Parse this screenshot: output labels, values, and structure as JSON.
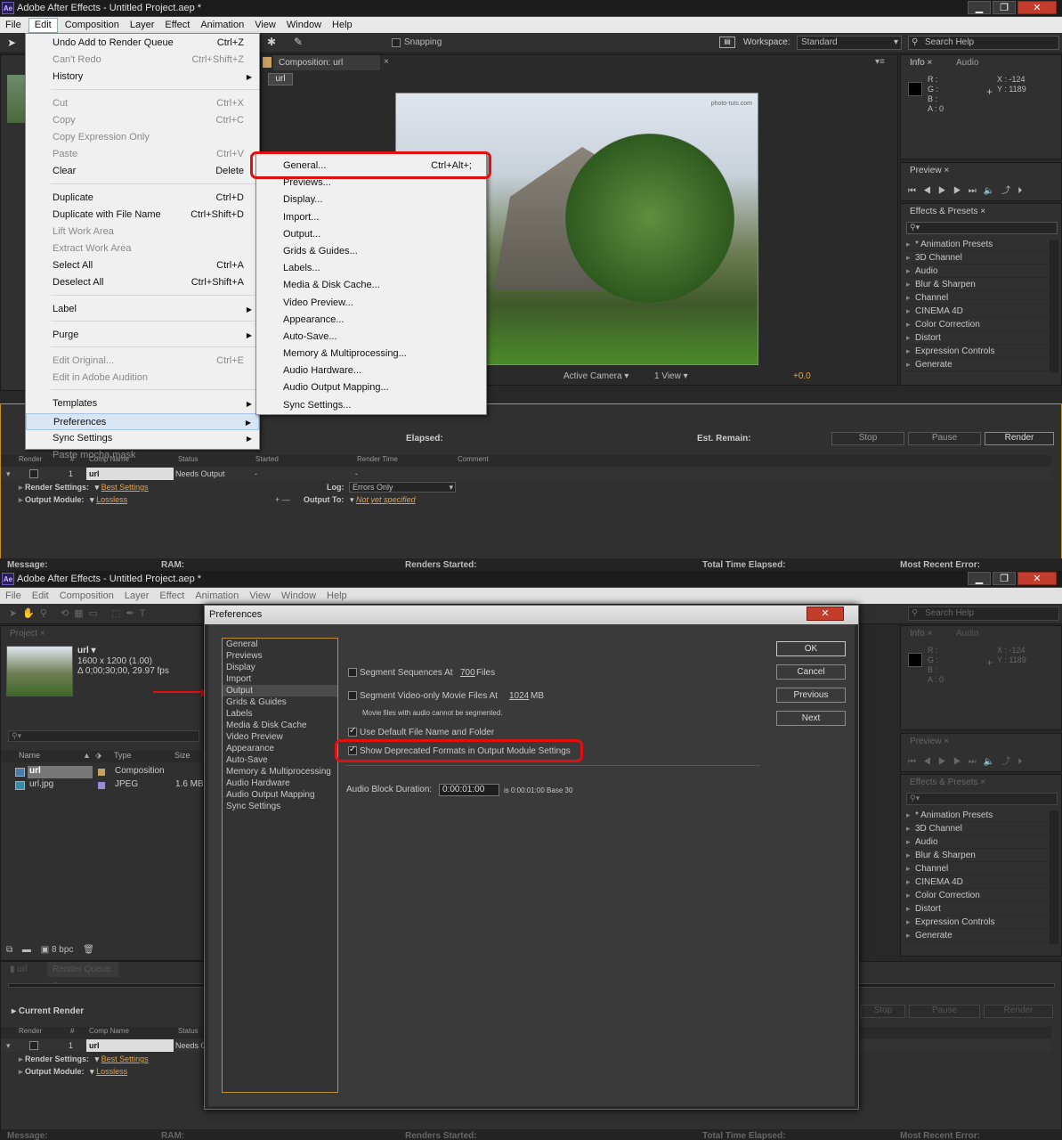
{
  "shot1": {
    "title": "Adobe After Effects - Untitled Project.aep *",
    "menus": [
      "File",
      "Edit",
      "Composition",
      "Layer",
      "Effect",
      "Animation",
      "View",
      "Window",
      "Help"
    ],
    "active_menu": "Edit",
    "snapping": "Snapping",
    "workspace_label": "Workspace:",
    "workspace_value": "Standard",
    "search_help": "Search Help",
    "comp_tab": "Composition: url",
    "comp_name": "url",
    "watermark": "photo-tuts.com",
    "active_camera": "Active Camera",
    "view_count": "1 View",
    "exposure": "+0.0",
    "info_tab": "Info",
    "audio_tab": "Audio",
    "info_rgba": [
      "R :",
      "G :",
      "B :",
      "A : 0"
    ],
    "info_xy": [
      "X : -124",
      "Y : 1189"
    ],
    "preview_tab": "Preview",
    "effects_tab": "Effects & Presets",
    "effects": [
      "* Animation Presets",
      "3D Channel",
      "Audio",
      "Blur & Sharpen",
      "Channel",
      "CINEMA 4D",
      "Color Correction",
      "Distort",
      "Expression Controls",
      "Generate"
    ],
    "edit_menu": [
      {
        "label": "Undo Add to Render Queue",
        "sc": "Ctrl+Z"
      },
      {
        "label": "Can't Redo",
        "sc": "Ctrl+Shift+Z",
        "dis": true
      },
      {
        "label": "History",
        "arrow": true,
        "sep": true
      },
      {
        "label": "Cut",
        "sc": "Ctrl+X",
        "dis": true
      },
      {
        "label": "Copy",
        "sc": "Ctrl+C",
        "dis": true
      },
      {
        "label": "Copy Expression Only",
        "dis": true
      },
      {
        "label": "Paste",
        "sc": "Ctrl+V",
        "dis": true
      },
      {
        "label": "Clear",
        "sc": "Delete",
        "sep": true
      },
      {
        "label": "Duplicate",
        "sc": "Ctrl+D"
      },
      {
        "label": "Duplicate with File Name",
        "sc": "Ctrl+Shift+D"
      },
      {
        "label": "Lift Work Area",
        "dis": true
      },
      {
        "label": "Extract Work Area",
        "dis": true
      },
      {
        "label": "Select All",
        "sc": "Ctrl+A"
      },
      {
        "label": "Deselect All",
        "sc": "Ctrl+Shift+A",
        "sep": true
      },
      {
        "label": "Label",
        "arrow": true,
        "sep": true
      },
      {
        "label": "Purge",
        "arrow": true,
        "sep": true
      },
      {
        "label": "Edit Original...",
        "sc": "Ctrl+E",
        "dis": true
      },
      {
        "label": "Edit in Adobe Audition",
        "dis": true,
        "sep": true
      },
      {
        "label": "Templates",
        "arrow": true
      },
      {
        "label": "Preferences",
        "arrow": true,
        "hl": true
      },
      {
        "label": "Sync Settings",
        "arrow": true
      },
      {
        "label": "Paste mocha mask",
        "dis": true
      }
    ],
    "prefs_submenu": [
      {
        "label": "General...",
        "sc": "Ctrl+Alt+;"
      },
      {
        "label": "Previews..."
      },
      {
        "label": "Display..."
      },
      {
        "label": "Import..."
      },
      {
        "label": "Output..."
      },
      {
        "label": "Grids & Guides..."
      },
      {
        "label": "Labels..."
      },
      {
        "label": "Media & Disk Cache..."
      },
      {
        "label": "Video Preview..."
      },
      {
        "label": "Appearance..."
      },
      {
        "label": "Auto-Save..."
      },
      {
        "label": "Memory & Multiprocessing..."
      },
      {
        "label": "Audio Hardware..."
      },
      {
        "label": "Audio Output Mapping..."
      },
      {
        "label": "Sync Settings..."
      }
    ],
    "rq": {
      "elapsed": "Elapsed:",
      "est_remain": "Est. Remain:",
      "stop": "Stop",
      "pause": "Pause",
      "render": "Render",
      "cols": [
        "Render",
        "#",
        "Comp Name",
        "Status",
        "Started",
        "Render Time",
        "Comment"
      ],
      "row_num": "1",
      "row_name": "url",
      "row_status": "Needs Output",
      "row_started": "-",
      "row_rtime": "-",
      "render_settings_label": "Render Settings:",
      "render_settings": "Best Settings",
      "log_label": "Log:",
      "log_value": "Errors Only",
      "output_module_label": "Output Module:",
      "output_module": "Lossless",
      "output_to_label": "Output To:",
      "output_to": "Not yet specified"
    },
    "status": [
      "Message:",
      "RAM:",
      "Renders Started:",
      "Total Time Elapsed:",
      "Most Recent Error:"
    ]
  },
  "shot2": {
    "title": "Adobe After Effects - Untitled Project.aep *",
    "menus": [
      "File",
      "Edit",
      "Composition",
      "Layer",
      "Effect",
      "Animation",
      "View",
      "Window",
      "Help"
    ],
    "project_tab": "Project",
    "proj_name": "url ▾",
    "proj_info1": "1600 x 1200 (1.00)",
    "proj_info2": "Δ 0;00;30;00, 29.97 fps",
    "proj_cols": [
      "Name",
      "Type",
      "Size"
    ],
    "proj_rows": [
      {
        "name": "url",
        "type": "Composition",
        "size": ""
      },
      {
        "name": "url.jpg",
        "type": "JPEG",
        "size": "1.6 MB"
      }
    ],
    "bpc": "8 bpc",
    "search_help": "Search Help",
    "info_tab": "Info",
    "audio_tab": "Audio",
    "info_rgba": [
      "R :",
      "G :",
      "B :",
      "A : 0"
    ],
    "info_xy": [
      "X : -124",
      "Y : 1189"
    ],
    "preview_tab": "Preview",
    "effects_tab": "Effects & Presets",
    "effects": [
      "* Animation Presets",
      "3D Channel",
      "Audio",
      "Blur & Sharpen",
      "Channel",
      "CINEMA 4D",
      "Color Correction",
      "Distort",
      "Expression Controls",
      "Generate"
    ],
    "rq_tabs": [
      "url",
      "Render Queue"
    ],
    "current_render": "Current Render",
    "stop": "Stop",
    "pause": "Pause",
    "render": "Render",
    "rq_cols": [
      "Render",
      "#",
      "Comp Name",
      "Status"
    ],
    "row_num": "1",
    "row_name": "url",
    "row_status": "Needs O",
    "render_settings_label": "Render Settings:",
    "render_settings": "Best Settings",
    "output_module_label": "Output Module:",
    "output_module": "Lossless",
    "status": [
      "Message:",
      "RAM:",
      "Renders Started:",
      "Total Time Elapsed:",
      "Most Recent Error:"
    ],
    "dialog": {
      "title": "Preferences",
      "categories": [
        "General",
        "Previews",
        "Display",
        "Import",
        "Output",
        "Grids & Guides",
        "Labels",
        "Media & Disk Cache",
        "Video Preview",
        "Appearance",
        "Auto-Save",
        "Memory & Multiprocessing",
        "Audio Hardware",
        "Audio Output Mapping",
        "Sync Settings"
      ],
      "selected": "Output",
      "seg_seq_label": "Segment Sequences At",
      "seg_seq_value": "700",
      "seg_seq_unit": "Files",
      "seg_video_label": "Segment Video-only Movie Files At",
      "seg_video_value": "1024",
      "seg_video_unit": "MB",
      "seg_note": "Movie files with audio cannot be segmented.",
      "use_default_label": "Use Default File Name and Folder",
      "show_deprecated_label": "Show Deprecated Formats in Output Module Settings",
      "audio_block_label": "Audio Block Duration:",
      "audio_block_value": "0:00:01:00",
      "audio_block_note": "is 0:00:01:00  Base 30",
      "ok": "OK",
      "cancel": "Cancel",
      "previous": "Previous",
      "next": "Next"
    }
  },
  "colors": {
    "highlight": "#e01010",
    "accent_link": "#e8a33a",
    "selection_border": "#c0902f"
  }
}
